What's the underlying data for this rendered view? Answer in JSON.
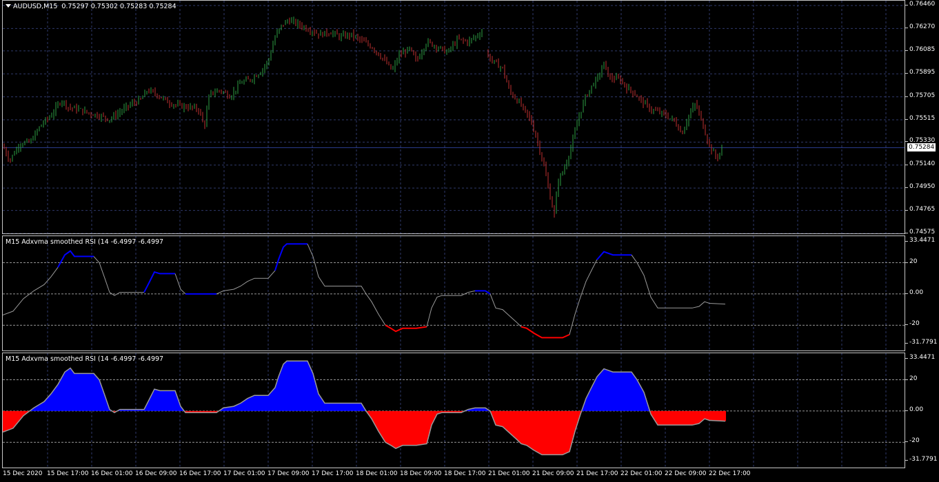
{
  "header": {
    "symbol": "AUDUSD,M15",
    "ohlc": "0.75297 0.75302 0.75283 0.75284"
  },
  "indicator_title": "M15 Adxvma smoothed RSI  (14 -6.4997 -6.4997",
  "price_tag": "0.75284",
  "colors": {
    "background": "#000000",
    "grid": "#2f3a6b",
    "bull_candle": "#2ea043",
    "bear_candle": "#c03030",
    "rsi_up": "#0000ff",
    "rsi_down": "#ff0000",
    "rsi_neutral": "#9a9a9a",
    "current_price_line": "#2a3a8a"
  },
  "chart_data": [
    {
      "type": "candlestick",
      "title": "AUDUSD,M15",
      "ylim": [
        0.74575,
        0.7646
      ],
      "y_ticks": [
        "0.76460",
        "0.76270",
        "0.76085",
        "0.75895",
        "0.75705",
        "0.75515",
        "0.75330",
        "0.75140",
        "0.74950",
        "0.74765",
        "0.74575"
      ],
      "current_price": 0.75284,
      "close_path": [
        [
          0,
          0.753
        ],
        [
          10,
          0.7518
        ],
        [
          25,
          0.7532
        ],
        [
          40,
          0.7533
        ],
        [
          55,
          0.7547
        ],
        [
          70,
          0.7555
        ],
        [
          85,
          0.7568
        ],
        [
          95,
          0.7562
        ],
        [
          110,
          0.756
        ],
        [
          125,
          0.7557
        ],
        [
          140,
          0.7555
        ],
        [
          155,
          0.7552
        ],
        [
          170,
          0.7558
        ],
        [
          185,
          0.7564
        ],
        [
          200,
          0.7568
        ],
        [
          210,
          0.7576
        ],
        [
          225,
          0.7572
        ],
        [
          240,
          0.7566
        ],
        [
          255,
          0.7563
        ],
        [
          270,
          0.7562
        ],
        [
          285,
          0.756
        ],
        [
          292,
          0.7545
        ],
        [
          300,
          0.7573
        ],
        [
          315,
          0.7576
        ],
        [
          330,
          0.7571
        ],
        [
          345,
          0.7582
        ],
        [
          360,
          0.7585
        ],
        [
          375,
          0.7592
        ],
        [
          385,
          0.76
        ],
        [
          395,
          0.762
        ],
        [
          405,
          0.763
        ],
        [
          415,
          0.7634
        ],
        [
          430,
          0.763
        ],
        [
          445,
          0.7626
        ],
        [
          460,
          0.7622
        ],
        [
          475,
          0.7624
        ],
        [
          490,
          0.762
        ],
        [
          505,
          0.7622
        ],
        [
          520,
          0.7617
        ],
        [
          535,
          0.7612
        ],
        [
          550,
          0.7603
        ],
        [
          565,
          0.7592
        ],
        [
          575,
          0.7605
        ],
        [
          590,
          0.761
        ],
        [
          600,
          0.76
        ],
        [
          615,
          0.7616
        ],
        [
          630,
          0.7612
        ],
        [
          645,
          0.7607
        ],
        [
          660,
          0.7618
        ],
        [
          675,
          0.7616
        ],
        [
          690,
          0.7622
        ],
        [
          697,
          0.7625
        ],
        [
          702,
          0.7605
        ],
        [
          715,
          0.7598
        ],
        [
          725,
          0.7594
        ],
        [
          735,
          0.7575
        ],
        [
          750,
          0.7565
        ],
        [
          765,
          0.7552
        ],
        [
          775,
          0.7535
        ],
        [
          785,
          0.7513
        ],
        [
          795,
          0.7485
        ],
        [
          800,
          0.7473
        ],
        [
          805,
          0.75
        ],
        [
          815,
          0.7512
        ],
        [
          825,
          0.753
        ],
        [
          835,
          0.7553
        ],
        [
          845,
          0.757
        ],
        [
          855,
          0.758
        ],
        [
          865,
          0.7588
        ],
        [
          872,
          0.7598
        ],
        [
          880,
          0.7586
        ],
        [
          895,
          0.7585
        ],
        [
          905,
          0.7578
        ],
        [
          915,
          0.7574
        ],
        [
          925,
          0.7568
        ],
        [
          940,
          0.756
        ],
        [
          955,
          0.7557
        ],
        [
          965,
          0.7554
        ],
        [
          975,
          0.755
        ],
        [
          985,
          0.754
        ],
        [
          995,
          0.7555
        ],
        [
          1005,
          0.7565
        ],
        [
          1015,
          0.7548
        ],
        [
          1025,
          0.753
        ],
        [
          1035,
          0.752
        ],
        [
          1045,
          0.7528
        ]
      ]
    },
    {
      "type": "line",
      "title": "M15 Adxvma smoothed RSI  (14 -6.4997 -6.4997",
      "ylim": [
        -31.7791,
        33.4471
      ],
      "y_ticks": [
        "33.4471",
        "20",
        "0.00",
        "-20",
        "-31.7791"
      ],
      "levels": [
        20,
        0,
        -20
      ],
      "series": [
        {
          "color": "neutral",
          "points": [
            [
              0,
              -13.5
            ],
            [
              15,
              -11
            ],
            [
              30,
              -3
            ],
            [
              45,
              2
            ],
            [
              60,
              6
            ],
            [
              70,
              11
            ],
            [
              80,
              17
            ]
          ]
        },
        {
          "color": "up",
          "points": [
            [
              80,
              17
            ],
            [
              90,
              25
            ],
            [
              98,
              27.5
            ],
            [
              104,
              24
            ],
            [
              120,
              24
            ],
            [
              132,
              24
            ]
          ]
        },
        {
          "color": "neutral",
          "points": [
            [
              132,
              24
            ],
            [
              140,
              20
            ],
            [
              148,
              10
            ],
            [
              155,
              1
            ],
            [
              162,
              -1
            ],
            [
              170,
              1
            ],
            [
              190,
              1
            ],
            [
              205,
              1
            ]
          ]
        },
        {
          "color": "up",
          "points": [
            [
              205,
              1
            ],
            [
              212,
              7
            ],
            [
              220,
              14
            ],
            [
              228,
              13
            ],
            [
              240,
              13
            ],
            [
              250,
              13
            ]
          ]
        },
        {
          "color": "neutral",
          "points": [
            [
              250,
              13
            ],
            [
              258,
              3
            ],
            [
              265,
              0
            ]
          ]
        },
        {
          "color": "up",
          "points": [
            [
              265,
              0
            ],
            [
              285,
              0
            ],
            [
              310,
              0
            ]
          ]
        },
        {
          "color": "neutral",
          "points": [
            [
              310,
              0
            ],
            [
              320,
              2
            ],
            [
              335,
              3
            ],
            [
              345,
              5
            ],
            [
              355,
              8
            ],
            [
              365,
              10
            ],
            [
              385,
              10
            ],
            [
              395,
              15
            ]
          ]
        },
        {
          "color": "up",
          "points": [
            [
              395,
              15
            ],
            [
              400,
              22
            ],
            [
              407,
              30
            ],
            [
              412,
              32
            ],
            [
              420,
              32
            ],
            [
              430,
              32
            ],
            [
              442,
              32
            ]
          ]
        },
        {
          "color": "neutral",
          "points": [
            [
              442,
              32
            ],
            [
              450,
              24
            ],
            [
              458,
              11
            ],
            [
              467,
              5
            ],
            [
              480,
              5
            ],
            [
              520,
              5
            ],
            [
              527,
              0
            ],
            [
              535,
              -5
            ],
            [
              545,
              -13
            ],
            [
              555,
              -20
            ]
          ]
        },
        {
          "color": "down",
          "points": [
            [
              555,
              -20
            ],
            [
              563,
              -22
            ],
            [
              570,
              -24
            ],
            [
              580,
              -22
            ],
            [
              600,
              -22
            ],
            [
              615,
              -21
            ]
          ]
        },
        {
          "color": "neutral",
          "points": [
            [
              615,
              -21
            ],
            [
              622,
              -9
            ],
            [
              630,
              -2
            ],
            [
              637,
              -1
            ],
            [
              650,
              -1
            ],
            [
              665,
              -1
            ],
            [
              675,
              1
            ],
            [
              685,
              2
            ]
          ]
        },
        {
          "color": "up",
          "points": [
            [
              685,
              2
            ],
            [
              700,
              2
            ],
            [
              707,
              0
            ]
          ]
        },
        {
          "color": "neutral",
          "points": [
            [
              707,
              0
            ],
            [
              715,
              -9
            ],
            [
              725,
              -10
            ],
            [
              735,
              -14
            ],
            [
              745,
              -18
            ],
            [
              752,
              -21
            ]
          ]
        },
        {
          "color": "down",
          "points": [
            [
              752,
              -21
            ],
            [
              760,
              -22
            ],
            [
              770,
              -25
            ],
            [
              782,
              -28
            ],
            [
              800,
              -28
            ],
            [
              812,
              -28
            ],
            [
              822,
              -26
            ]
          ]
        },
        {
          "color": "neutral",
          "points": [
            [
              822,
              -26
            ],
            [
              830,
              -13
            ],
            [
              838,
              -2
            ],
            [
              846,
              8
            ],
            [
              855,
              16
            ],
            [
              862,
              22
            ]
          ]
        },
        {
          "color": "up",
          "points": [
            [
              862,
              22
            ],
            [
              872,
              27
            ],
            [
              885,
              25
            ],
            [
              900,
              25
            ],
            [
              912,
              25
            ]
          ]
        },
        {
          "color": "neutral",
          "points": [
            [
              912,
              25
            ],
            [
              920,
              20
            ],
            [
              930,
              12
            ],
            [
              940,
              -2
            ],
            [
              950,
              -9
            ],
            [
              965,
              -9
            ],
            [
              1000,
              -9
            ],
            [
              1010,
              -8
            ],
            [
              1018,
              -5
            ],
            [
              1025,
              -6
            ],
            [
              1048,
              -6.4997
            ]
          ]
        }
      ]
    },
    {
      "type": "area",
      "title": "M15 Adxvma smoothed RSI  (14 -6.4997 -6.4997",
      "ylim": [
        -31.7791,
        33.4471
      ],
      "y_ticks": [
        "33.4471",
        "20",
        "0.00",
        "-20",
        "-31.7791"
      ],
      "levels": [
        20,
        0,
        -20
      ],
      "baseline": 0,
      "points": [
        [
          0,
          -13.5
        ],
        [
          15,
          -11
        ],
        [
          30,
          -3
        ],
        [
          45,
          2
        ],
        [
          60,
          6
        ],
        [
          70,
          11
        ],
        [
          80,
          17
        ],
        [
          90,
          25
        ],
        [
          98,
          27.5
        ],
        [
          104,
          24
        ],
        [
          120,
          24
        ],
        [
          132,
          24
        ],
        [
          140,
          20
        ],
        [
          148,
          10
        ],
        [
          155,
          1
        ],
        [
          162,
          -1
        ],
        [
          170,
          1
        ],
        [
          190,
          1
        ],
        [
          205,
          1
        ],
        [
          212,
          7
        ],
        [
          220,
          14
        ],
        [
          228,
          13
        ],
        [
          240,
          13
        ],
        [
          250,
          13
        ],
        [
          258,
          3
        ],
        [
          265,
          -1
        ],
        [
          285,
          -1
        ],
        [
          310,
          -1
        ],
        [
          320,
          2
        ],
        [
          335,
          3
        ],
        [
          345,
          5
        ],
        [
          355,
          8
        ],
        [
          365,
          10
        ],
        [
          385,
          10
        ],
        [
          395,
          15
        ],
        [
          400,
          22
        ],
        [
          407,
          30
        ],
        [
          412,
          32
        ],
        [
          420,
          32
        ],
        [
          430,
          32
        ],
        [
          442,
          32
        ],
        [
          450,
          24
        ],
        [
          458,
          11
        ],
        [
          467,
          5
        ],
        [
          480,
          5
        ],
        [
          520,
          5
        ],
        [
          527,
          0
        ],
        [
          535,
          -5
        ],
        [
          545,
          -13
        ],
        [
          555,
          -20
        ],
        [
          563,
          -22
        ],
        [
          570,
          -24
        ],
        [
          580,
          -22
        ],
        [
          600,
          -22
        ],
        [
          615,
          -21
        ],
        [
          622,
          -9
        ],
        [
          630,
          -2
        ],
        [
          637,
          -1
        ],
        [
          650,
          -1
        ],
        [
          665,
          -1
        ],
        [
          675,
          1
        ],
        [
          685,
          2
        ],
        [
          700,
          2
        ],
        [
          707,
          0
        ],
        [
          715,
          -9
        ],
        [
          725,
          -10
        ],
        [
          735,
          -14
        ],
        [
          745,
          -18
        ],
        [
          752,
          -21
        ],
        [
          760,
          -22
        ],
        [
          770,
          -25
        ],
        [
          782,
          -28
        ],
        [
          800,
          -28
        ],
        [
          812,
          -28
        ],
        [
          822,
          -26
        ],
        [
          830,
          -13
        ],
        [
          838,
          -2
        ],
        [
          846,
          8
        ],
        [
          855,
          16
        ],
        [
          862,
          22
        ],
        [
          872,
          27
        ],
        [
          885,
          25
        ],
        [
          900,
          25
        ],
        [
          912,
          25
        ],
        [
          920,
          20
        ],
        [
          930,
          12
        ],
        [
          940,
          -2
        ],
        [
          950,
          -9
        ],
        [
          965,
          -9
        ],
        [
          1000,
          -9
        ],
        [
          1010,
          -8
        ],
        [
          1018,
          -5
        ],
        [
          1025,
          -6
        ],
        [
          1048,
          -6.4997
        ]
      ]
    }
  ],
  "x_axis": {
    "ticks": [
      "15 Dec 2020",
      "15 Dec 17:00",
      "16 Dec 01:00",
      "16 Dec 09:00",
      "16 Dec 17:00",
      "17 Dec 01:00",
      "17 Dec 09:00",
      "17 Dec 17:00",
      "18 Dec 01:00",
      "18 Dec 09:00",
      "18 Dec 17:00",
      "21 Dec 01:00",
      "21 Dec 09:00",
      "21 Dec 17:00",
      "22 Dec 01:00",
      "22 Dec 09:00",
      "22 Dec 17:00"
    ]
  }
}
